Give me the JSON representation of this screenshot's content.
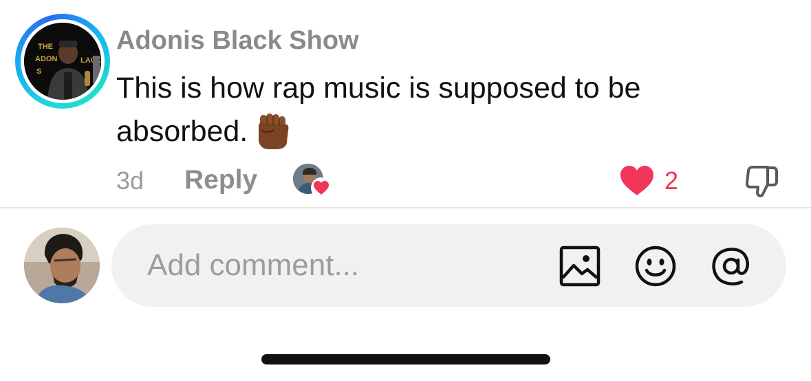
{
  "comment": {
    "author": "Adonis Black Show",
    "text": "This is how rap music is supposed to be absorbed.",
    "emoji": "raised-fist-medium-dark-skin",
    "time_ago": "3d",
    "reply_label": "Reply",
    "like_count": "2",
    "liked_by_creator": true,
    "colors": {
      "author": "#8a8a8a",
      "like": "#f0365a",
      "story_ring": "#1fd6e0"
    }
  },
  "composer": {
    "placeholder": "Add comment...",
    "icons": [
      "image-icon",
      "emoji-icon",
      "at-mention-icon"
    ]
  }
}
